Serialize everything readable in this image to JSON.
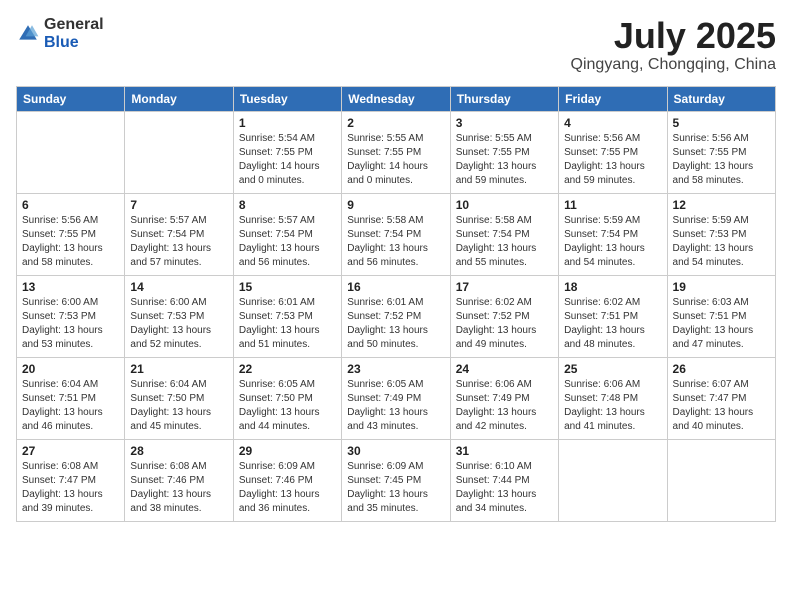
{
  "header": {
    "logo_general": "General",
    "logo_blue": "Blue",
    "month_year": "July 2025",
    "location": "Qingyang, Chongqing, China"
  },
  "columns": [
    "Sunday",
    "Monday",
    "Tuesday",
    "Wednesday",
    "Thursday",
    "Friday",
    "Saturday"
  ],
  "weeks": [
    [
      {
        "day": "",
        "sunrise": "",
        "sunset": "",
        "daylight": ""
      },
      {
        "day": "",
        "sunrise": "",
        "sunset": "",
        "daylight": ""
      },
      {
        "day": "1",
        "sunrise": "Sunrise: 5:54 AM",
        "sunset": "Sunset: 7:55 PM",
        "daylight": "Daylight: 14 hours and 0 minutes."
      },
      {
        "day": "2",
        "sunrise": "Sunrise: 5:55 AM",
        "sunset": "Sunset: 7:55 PM",
        "daylight": "Daylight: 14 hours and 0 minutes."
      },
      {
        "day": "3",
        "sunrise": "Sunrise: 5:55 AM",
        "sunset": "Sunset: 7:55 PM",
        "daylight": "Daylight: 13 hours and 59 minutes."
      },
      {
        "day": "4",
        "sunrise": "Sunrise: 5:56 AM",
        "sunset": "Sunset: 7:55 PM",
        "daylight": "Daylight: 13 hours and 59 minutes."
      },
      {
        "day": "5",
        "sunrise": "Sunrise: 5:56 AM",
        "sunset": "Sunset: 7:55 PM",
        "daylight": "Daylight: 13 hours and 58 minutes."
      }
    ],
    [
      {
        "day": "6",
        "sunrise": "Sunrise: 5:56 AM",
        "sunset": "Sunset: 7:55 PM",
        "daylight": "Daylight: 13 hours and 58 minutes."
      },
      {
        "day": "7",
        "sunrise": "Sunrise: 5:57 AM",
        "sunset": "Sunset: 7:54 PM",
        "daylight": "Daylight: 13 hours and 57 minutes."
      },
      {
        "day": "8",
        "sunrise": "Sunrise: 5:57 AM",
        "sunset": "Sunset: 7:54 PM",
        "daylight": "Daylight: 13 hours and 56 minutes."
      },
      {
        "day": "9",
        "sunrise": "Sunrise: 5:58 AM",
        "sunset": "Sunset: 7:54 PM",
        "daylight": "Daylight: 13 hours and 56 minutes."
      },
      {
        "day": "10",
        "sunrise": "Sunrise: 5:58 AM",
        "sunset": "Sunset: 7:54 PM",
        "daylight": "Daylight: 13 hours and 55 minutes."
      },
      {
        "day": "11",
        "sunrise": "Sunrise: 5:59 AM",
        "sunset": "Sunset: 7:54 PM",
        "daylight": "Daylight: 13 hours and 54 minutes."
      },
      {
        "day": "12",
        "sunrise": "Sunrise: 5:59 AM",
        "sunset": "Sunset: 7:53 PM",
        "daylight": "Daylight: 13 hours and 54 minutes."
      }
    ],
    [
      {
        "day": "13",
        "sunrise": "Sunrise: 6:00 AM",
        "sunset": "Sunset: 7:53 PM",
        "daylight": "Daylight: 13 hours and 53 minutes."
      },
      {
        "day": "14",
        "sunrise": "Sunrise: 6:00 AM",
        "sunset": "Sunset: 7:53 PM",
        "daylight": "Daylight: 13 hours and 52 minutes."
      },
      {
        "day": "15",
        "sunrise": "Sunrise: 6:01 AM",
        "sunset": "Sunset: 7:53 PM",
        "daylight": "Daylight: 13 hours and 51 minutes."
      },
      {
        "day": "16",
        "sunrise": "Sunrise: 6:01 AM",
        "sunset": "Sunset: 7:52 PM",
        "daylight": "Daylight: 13 hours and 50 minutes."
      },
      {
        "day": "17",
        "sunrise": "Sunrise: 6:02 AM",
        "sunset": "Sunset: 7:52 PM",
        "daylight": "Daylight: 13 hours and 49 minutes."
      },
      {
        "day": "18",
        "sunrise": "Sunrise: 6:02 AM",
        "sunset": "Sunset: 7:51 PM",
        "daylight": "Daylight: 13 hours and 48 minutes."
      },
      {
        "day": "19",
        "sunrise": "Sunrise: 6:03 AM",
        "sunset": "Sunset: 7:51 PM",
        "daylight": "Daylight: 13 hours and 47 minutes."
      }
    ],
    [
      {
        "day": "20",
        "sunrise": "Sunrise: 6:04 AM",
        "sunset": "Sunset: 7:51 PM",
        "daylight": "Daylight: 13 hours and 46 minutes."
      },
      {
        "day": "21",
        "sunrise": "Sunrise: 6:04 AM",
        "sunset": "Sunset: 7:50 PM",
        "daylight": "Daylight: 13 hours and 45 minutes."
      },
      {
        "day": "22",
        "sunrise": "Sunrise: 6:05 AM",
        "sunset": "Sunset: 7:50 PM",
        "daylight": "Daylight: 13 hours and 44 minutes."
      },
      {
        "day": "23",
        "sunrise": "Sunrise: 6:05 AM",
        "sunset": "Sunset: 7:49 PM",
        "daylight": "Daylight: 13 hours and 43 minutes."
      },
      {
        "day": "24",
        "sunrise": "Sunrise: 6:06 AM",
        "sunset": "Sunset: 7:49 PM",
        "daylight": "Daylight: 13 hours and 42 minutes."
      },
      {
        "day": "25",
        "sunrise": "Sunrise: 6:06 AM",
        "sunset": "Sunset: 7:48 PM",
        "daylight": "Daylight: 13 hours and 41 minutes."
      },
      {
        "day": "26",
        "sunrise": "Sunrise: 6:07 AM",
        "sunset": "Sunset: 7:47 PM",
        "daylight": "Daylight: 13 hours and 40 minutes."
      }
    ],
    [
      {
        "day": "27",
        "sunrise": "Sunrise: 6:08 AM",
        "sunset": "Sunset: 7:47 PM",
        "daylight": "Daylight: 13 hours and 39 minutes."
      },
      {
        "day": "28",
        "sunrise": "Sunrise: 6:08 AM",
        "sunset": "Sunset: 7:46 PM",
        "daylight": "Daylight: 13 hours and 38 minutes."
      },
      {
        "day": "29",
        "sunrise": "Sunrise: 6:09 AM",
        "sunset": "Sunset: 7:46 PM",
        "daylight": "Daylight: 13 hours and 36 minutes."
      },
      {
        "day": "30",
        "sunrise": "Sunrise: 6:09 AM",
        "sunset": "Sunset: 7:45 PM",
        "daylight": "Daylight: 13 hours and 35 minutes."
      },
      {
        "day": "31",
        "sunrise": "Sunrise: 6:10 AM",
        "sunset": "Sunset: 7:44 PM",
        "daylight": "Daylight: 13 hours and 34 minutes."
      },
      {
        "day": "",
        "sunrise": "",
        "sunset": "",
        "daylight": ""
      },
      {
        "day": "",
        "sunrise": "",
        "sunset": "",
        "daylight": ""
      }
    ]
  ]
}
